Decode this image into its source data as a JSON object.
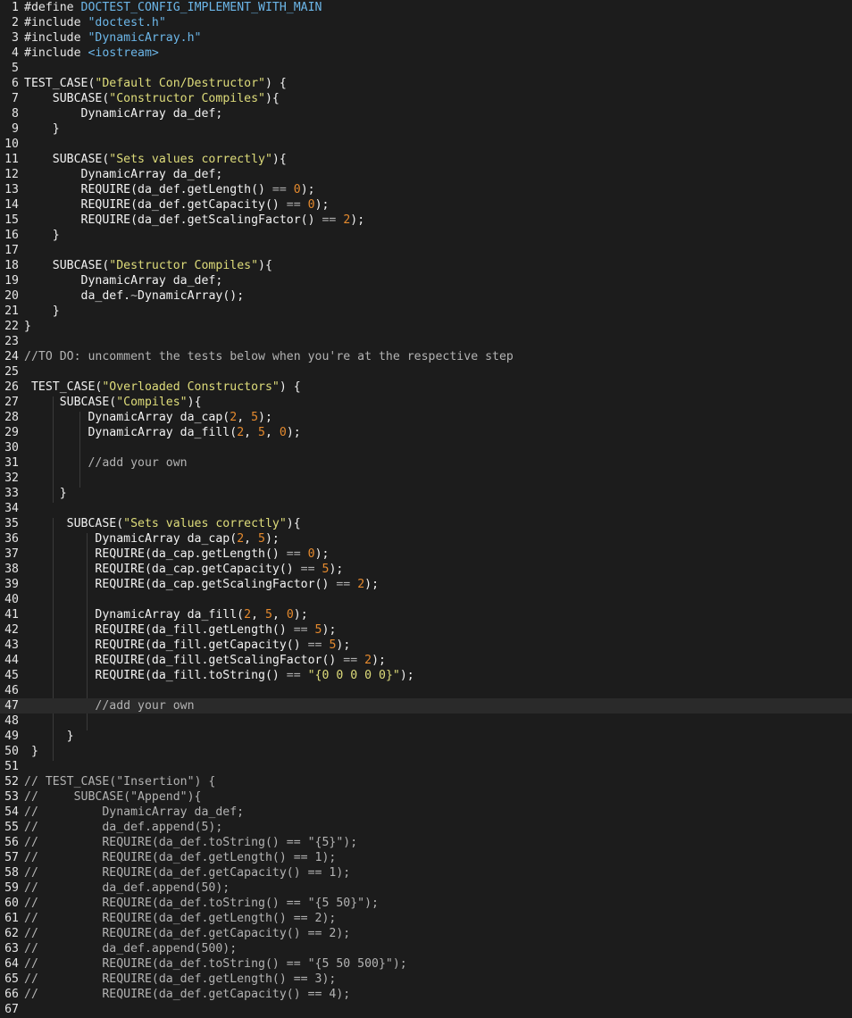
{
  "editor": {
    "colors": {
      "background": "#1c1c1c",
      "active_line": "#2a2a2a",
      "string": "#dedc7a",
      "number": "#e58a2e",
      "macro": "#6cb6e8",
      "comment": "#b3b3b3"
    },
    "active_line": 47,
    "lines": [
      {
        "n": "1",
        "tokens": [
          {
            "t": "#define ",
            "c": "pre"
          },
          {
            "t": "DOCTEST_CONFIG_IMPLEMENT_WITH_MAIN",
            "c": "macro"
          }
        ]
      },
      {
        "n": "2",
        "tokens": [
          {
            "t": "#include ",
            "c": "pre"
          },
          {
            "t": "\"doctest.h\"",
            "c": "macro"
          }
        ]
      },
      {
        "n": "3",
        "tokens": [
          {
            "t": "#include ",
            "c": "pre"
          },
          {
            "t": "\"DynamicArray.h\"",
            "c": "macro"
          }
        ]
      },
      {
        "n": "4",
        "tokens": [
          {
            "t": "#include ",
            "c": "pre"
          },
          {
            "t": "<iostream>",
            "c": "macro"
          }
        ]
      },
      {
        "n": "5",
        "tokens": []
      },
      {
        "n": "6",
        "tokens": [
          {
            "t": "TEST_CASE(",
            "c": "plain"
          },
          {
            "t": "\"Default Con/Destructor\"",
            "c": "str"
          },
          {
            "t": ") {",
            "c": "plain"
          }
        ]
      },
      {
        "n": "7",
        "tokens": [
          {
            "t": "    SUBCASE(",
            "c": "plain"
          },
          {
            "t": "\"Constructor Compiles\"",
            "c": "str"
          },
          {
            "t": "){",
            "c": "plain"
          }
        ]
      },
      {
        "n": "8",
        "tokens": [
          {
            "t": "        DynamicArray da_def;",
            "c": "plain"
          }
        ]
      },
      {
        "n": "9",
        "tokens": [
          {
            "t": "    }",
            "c": "plain"
          }
        ]
      },
      {
        "n": "10",
        "tokens": []
      },
      {
        "n": "11",
        "tokens": [
          {
            "t": "    SUBCASE(",
            "c": "plain"
          },
          {
            "t": "\"Sets values correctly\"",
            "c": "str"
          },
          {
            "t": "){",
            "c": "plain"
          }
        ]
      },
      {
        "n": "12",
        "tokens": [
          {
            "t": "        DynamicArray da_def;",
            "c": "plain"
          }
        ]
      },
      {
        "n": "13",
        "tokens": [
          {
            "t": "        REQUIRE(da_def.getLength() ",
            "c": "plain"
          },
          {
            "t": "==",
            "c": "op"
          },
          {
            "t": " ",
            "c": "plain"
          },
          {
            "t": "0",
            "c": "num"
          },
          {
            "t": ");",
            "c": "plain"
          }
        ]
      },
      {
        "n": "14",
        "tokens": [
          {
            "t": "        REQUIRE(da_def.getCapacity() ",
            "c": "plain"
          },
          {
            "t": "==",
            "c": "op"
          },
          {
            "t": " ",
            "c": "plain"
          },
          {
            "t": "0",
            "c": "num"
          },
          {
            "t": ");",
            "c": "plain"
          }
        ]
      },
      {
        "n": "15",
        "tokens": [
          {
            "t": "        REQUIRE(da_def.getScalingFactor() ",
            "c": "plain"
          },
          {
            "t": "==",
            "c": "op"
          },
          {
            "t": " ",
            "c": "plain"
          },
          {
            "t": "2",
            "c": "num"
          },
          {
            "t": ");",
            "c": "plain"
          }
        ]
      },
      {
        "n": "16",
        "tokens": [
          {
            "t": "    }",
            "c": "plain"
          }
        ]
      },
      {
        "n": "17",
        "tokens": []
      },
      {
        "n": "18",
        "tokens": [
          {
            "t": "    SUBCASE(",
            "c": "plain"
          },
          {
            "t": "\"Destructor Compiles\"",
            "c": "str"
          },
          {
            "t": "){",
            "c": "plain"
          }
        ]
      },
      {
        "n": "19",
        "tokens": [
          {
            "t": "        DynamicArray da_def;",
            "c": "plain"
          }
        ]
      },
      {
        "n": "20",
        "tokens": [
          {
            "t": "        da_def.",
            "c": "plain"
          },
          {
            "t": "~",
            "c": "op"
          },
          {
            "t": "DynamicArray();",
            "c": "plain"
          }
        ]
      },
      {
        "n": "21",
        "tokens": [
          {
            "t": "    }",
            "c": "plain"
          }
        ]
      },
      {
        "n": "22",
        "tokens": [
          {
            "t": "}",
            "c": "plain"
          }
        ]
      },
      {
        "n": "23",
        "tokens": []
      },
      {
        "n": "24",
        "tokens": [
          {
            "t": "//TO DO: uncomment the tests below when you're at the respective step",
            "c": "com"
          }
        ]
      },
      {
        "n": "25",
        "tokens": []
      },
      {
        "n": "26",
        "tokens": [
          {
            "t": " TEST_CASE(",
            "c": "plain"
          },
          {
            "t": "\"Overloaded Constructors\"",
            "c": "str"
          },
          {
            "t": ") {",
            "c": "plain"
          }
        ]
      },
      {
        "n": "27",
        "tokens": [
          {
            "t": "     SUBCASE(",
            "c": "plain"
          },
          {
            "t": "\"Compiles\"",
            "c": "str"
          },
          {
            "t": "){",
            "c": "plain"
          }
        ]
      },
      {
        "n": "28",
        "tokens": [
          {
            "t": "         DynamicArray da_cap(",
            "c": "plain"
          },
          {
            "t": "2",
            "c": "num"
          },
          {
            "t": ", ",
            "c": "plain"
          },
          {
            "t": "5",
            "c": "num"
          },
          {
            "t": ");",
            "c": "plain"
          }
        ]
      },
      {
        "n": "29",
        "tokens": [
          {
            "t": "         DynamicArray da_fill(",
            "c": "plain"
          },
          {
            "t": "2",
            "c": "num"
          },
          {
            "t": ", ",
            "c": "plain"
          },
          {
            "t": "5",
            "c": "num"
          },
          {
            "t": ", ",
            "c": "plain"
          },
          {
            "t": "0",
            "c": "num"
          },
          {
            "t": ");",
            "c": "plain"
          }
        ]
      },
      {
        "n": "30",
        "tokens": []
      },
      {
        "n": "31",
        "tokens": [
          {
            "t": "         //add your own",
            "c": "com"
          }
        ]
      },
      {
        "n": "32",
        "tokens": []
      },
      {
        "n": "33",
        "tokens": [
          {
            "t": "     }",
            "c": "plain"
          }
        ]
      },
      {
        "n": "34",
        "tokens": []
      },
      {
        "n": "35",
        "tokens": [
          {
            "t": "      SUBCASE(",
            "c": "plain"
          },
          {
            "t": "\"Sets values correctly\"",
            "c": "str"
          },
          {
            "t": "){",
            "c": "plain"
          }
        ]
      },
      {
        "n": "36",
        "tokens": [
          {
            "t": "          DynamicArray da_cap(",
            "c": "plain"
          },
          {
            "t": "2",
            "c": "num"
          },
          {
            "t": ", ",
            "c": "plain"
          },
          {
            "t": "5",
            "c": "num"
          },
          {
            "t": ");",
            "c": "plain"
          }
        ]
      },
      {
        "n": "37",
        "tokens": [
          {
            "t": "          REQUIRE(da_cap.getLength() ",
            "c": "plain"
          },
          {
            "t": "==",
            "c": "op"
          },
          {
            "t": " ",
            "c": "plain"
          },
          {
            "t": "0",
            "c": "num"
          },
          {
            "t": ");",
            "c": "plain"
          }
        ]
      },
      {
        "n": "38",
        "tokens": [
          {
            "t": "          REQUIRE(da_cap.getCapacity() ",
            "c": "plain"
          },
          {
            "t": "==",
            "c": "op"
          },
          {
            "t": " ",
            "c": "plain"
          },
          {
            "t": "5",
            "c": "num"
          },
          {
            "t": ");",
            "c": "plain"
          }
        ]
      },
      {
        "n": "39",
        "tokens": [
          {
            "t": "          REQUIRE(da_cap.getScalingFactor() ",
            "c": "plain"
          },
          {
            "t": "==",
            "c": "op"
          },
          {
            "t": " ",
            "c": "plain"
          },
          {
            "t": "2",
            "c": "num"
          },
          {
            "t": ");",
            "c": "plain"
          }
        ]
      },
      {
        "n": "40",
        "tokens": []
      },
      {
        "n": "41",
        "tokens": [
          {
            "t": "          DynamicArray da_fill(",
            "c": "plain"
          },
          {
            "t": "2",
            "c": "num"
          },
          {
            "t": ", ",
            "c": "plain"
          },
          {
            "t": "5",
            "c": "num"
          },
          {
            "t": ", ",
            "c": "plain"
          },
          {
            "t": "0",
            "c": "num"
          },
          {
            "t": ");",
            "c": "plain"
          }
        ]
      },
      {
        "n": "42",
        "tokens": [
          {
            "t": "          REQUIRE(da_fill.getLength() ",
            "c": "plain"
          },
          {
            "t": "==",
            "c": "op"
          },
          {
            "t": " ",
            "c": "plain"
          },
          {
            "t": "5",
            "c": "num"
          },
          {
            "t": ");",
            "c": "plain"
          }
        ]
      },
      {
        "n": "43",
        "tokens": [
          {
            "t": "          REQUIRE(da_fill.getCapacity() ",
            "c": "plain"
          },
          {
            "t": "==",
            "c": "op"
          },
          {
            "t": " ",
            "c": "plain"
          },
          {
            "t": "5",
            "c": "num"
          },
          {
            "t": ");",
            "c": "plain"
          }
        ]
      },
      {
        "n": "44",
        "tokens": [
          {
            "t": "          REQUIRE(da_fill.getScalingFactor() ",
            "c": "plain"
          },
          {
            "t": "==",
            "c": "op"
          },
          {
            "t": " ",
            "c": "plain"
          },
          {
            "t": "2",
            "c": "num"
          },
          {
            "t": ");",
            "c": "plain"
          }
        ]
      },
      {
        "n": "45",
        "tokens": [
          {
            "t": "          REQUIRE(da_fill.toString() ",
            "c": "plain"
          },
          {
            "t": "==",
            "c": "op"
          },
          {
            "t": " ",
            "c": "plain"
          },
          {
            "t": "\"{0 0 0 0 0}\"",
            "c": "str"
          },
          {
            "t": ");",
            "c": "plain"
          }
        ]
      },
      {
        "n": "46",
        "tokens": []
      },
      {
        "n": "47",
        "tokens": [
          {
            "t": "          //add your own",
            "c": "com"
          }
        ]
      },
      {
        "n": "48",
        "tokens": []
      },
      {
        "n": "49",
        "tokens": [
          {
            "t": "      }",
            "c": "plain"
          }
        ]
      },
      {
        "n": "50",
        "tokens": [
          {
            "t": " }",
            "c": "plain"
          }
        ]
      },
      {
        "n": "51",
        "tokens": []
      },
      {
        "n": "52",
        "tokens": [
          {
            "t": "// TEST_CASE(\"Insertion\") {",
            "c": "com"
          }
        ]
      },
      {
        "n": "53",
        "tokens": [
          {
            "t": "//     SUBCASE(\"Append\"){",
            "c": "com"
          }
        ]
      },
      {
        "n": "54",
        "tokens": [
          {
            "t": "//         DynamicArray da_def;",
            "c": "com"
          }
        ]
      },
      {
        "n": "55",
        "tokens": [
          {
            "t": "//         da_def.append(5);",
            "c": "com"
          }
        ]
      },
      {
        "n": "56",
        "tokens": [
          {
            "t": "//         REQUIRE(da_def.toString() == \"{5}\");",
            "c": "com"
          }
        ]
      },
      {
        "n": "57",
        "tokens": [
          {
            "t": "//         REQUIRE(da_def.getLength() == 1);",
            "c": "com"
          }
        ]
      },
      {
        "n": "58",
        "tokens": [
          {
            "t": "//         REQUIRE(da_def.getCapacity() == 1);",
            "c": "com"
          }
        ]
      },
      {
        "n": "59",
        "tokens": [
          {
            "t": "//         da_def.append(50);",
            "c": "com"
          }
        ]
      },
      {
        "n": "60",
        "tokens": [
          {
            "t": "//         REQUIRE(da_def.toString() == \"{5 50}\");",
            "c": "com"
          }
        ]
      },
      {
        "n": "61",
        "tokens": [
          {
            "t": "//         REQUIRE(da_def.getLength() == 2);",
            "c": "com"
          }
        ]
      },
      {
        "n": "62",
        "tokens": [
          {
            "t": "//         REQUIRE(da_def.getCapacity() == 2);",
            "c": "com"
          }
        ]
      },
      {
        "n": "63",
        "tokens": [
          {
            "t": "//         da_def.append(500);",
            "c": "com"
          }
        ]
      },
      {
        "n": "64",
        "tokens": [
          {
            "t": "//         REQUIRE(da_def.toString() == \"{5 50 500}\");",
            "c": "com"
          }
        ]
      },
      {
        "n": "65",
        "tokens": [
          {
            "t": "//         REQUIRE(da_def.getLength() == 3);",
            "c": "com"
          }
        ]
      },
      {
        "n": "66",
        "tokens": [
          {
            "t": "//         REQUIRE(da_def.getCapacity() == 4);",
            "c": "com"
          }
        ]
      },
      {
        "n": "67",
        "tokens": []
      }
    ]
  }
}
